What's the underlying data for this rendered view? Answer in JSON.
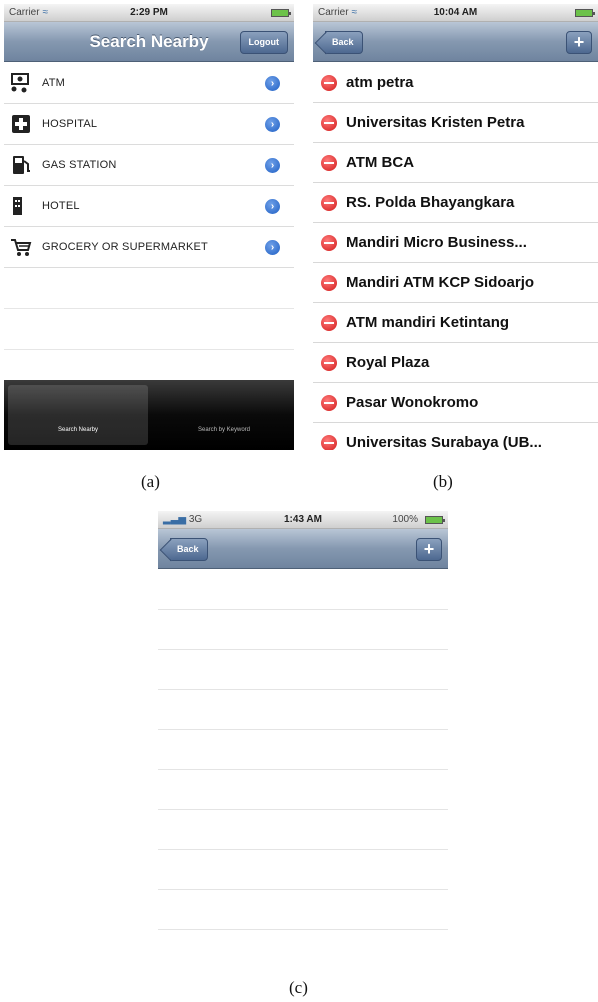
{
  "panel_a": {
    "status": {
      "carrier": "Carrier",
      "time": "2:29 PM"
    },
    "nav": {
      "title": "Search Nearby",
      "right_button": "Logout"
    },
    "items": [
      {
        "label": "ATM",
        "icon": "atm-icon"
      },
      {
        "label": "HOSPITAL",
        "icon": "hospital-icon"
      },
      {
        "label": "GAS STATION",
        "icon": "gas-pump-icon"
      },
      {
        "label": "HOTEL",
        "icon": "hotel-icon"
      },
      {
        "label": "GROCERY OR SUPERMARKET",
        "icon": "cart-icon"
      }
    ],
    "tabs": {
      "active": "Search Nearby",
      "inactive": "Search by Keyword"
    }
  },
  "panel_b": {
    "status": {
      "carrier": "Carrier",
      "time": "10:04 AM"
    },
    "nav": {
      "back_button": "Back",
      "add_button": "+"
    },
    "items": [
      "atm petra",
      "Universitas Kristen Petra",
      "ATM BCA",
      "RS. Polda Bhayangkara",
      "Mandiri Micro Business...",
      "Mandiri ATM KCP Sidoarjo",
      "ATM mandiri Ketintang",
      "Royal Plaza",
      "Pasar Wonokromo",
      "Universitas Surabaya (UB..."
    ]
  },
  "panel_c": {
    "status": {
      "carrier": "3G",
      "time": "1:43 AM",
      "battery": "100%"
    },
    "nav": {
      "back_button": "Back",
      "add_button": "+"
    }
  },
  "captions": {
    "a": "(a)",
    "b": "(b)",
    "c": "(c)"
  }
}
